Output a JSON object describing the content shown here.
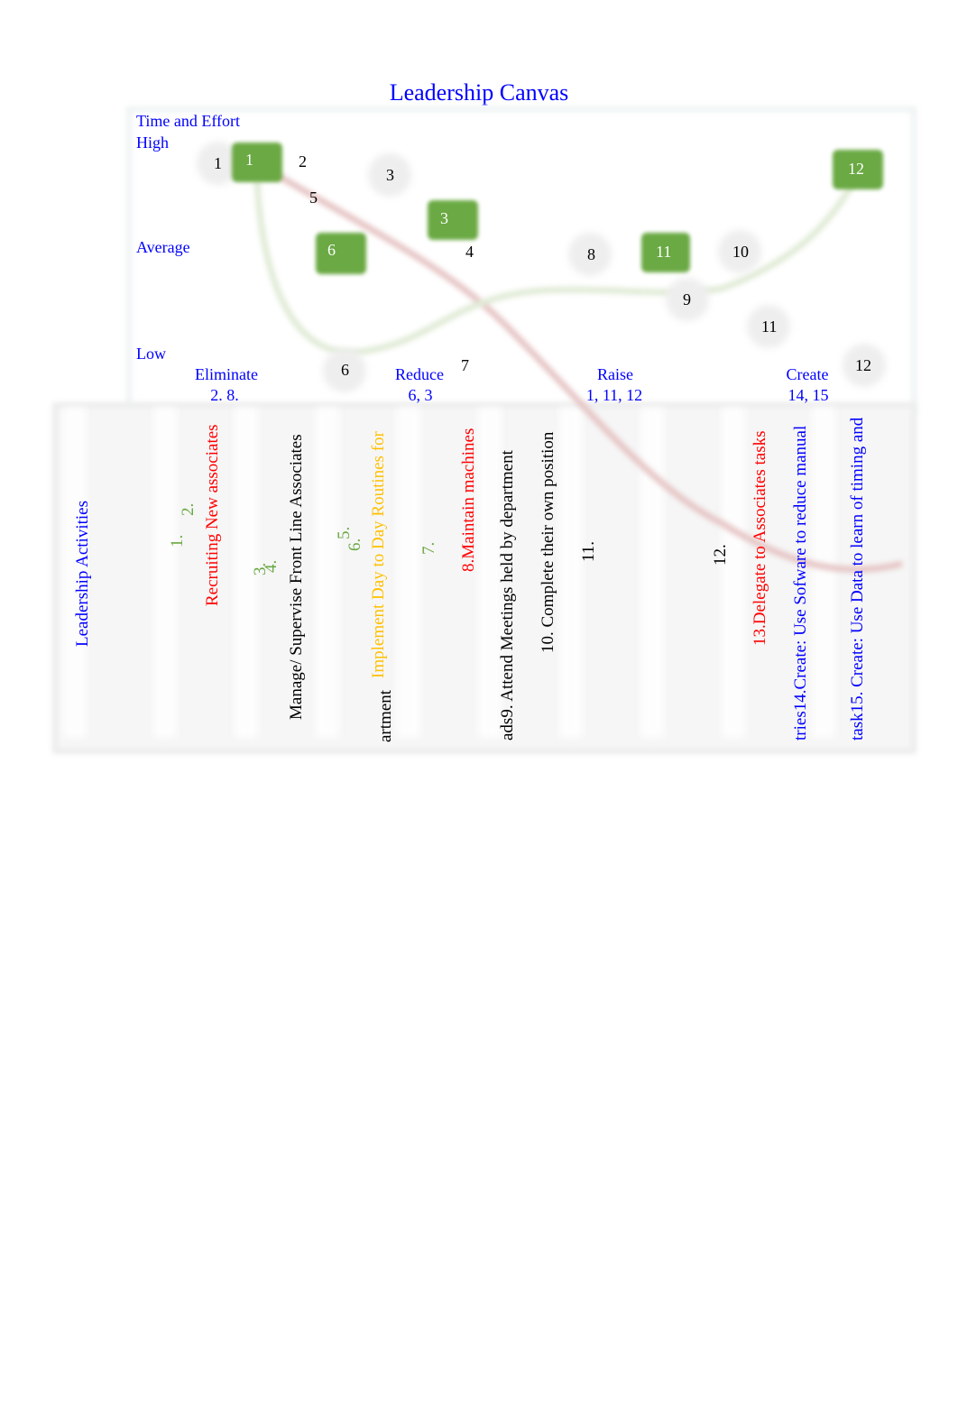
{
  "title": "Leadership Canvas",
  "axis": {
    "y_title": "Time and Effort",
    "high": "High",
    "average": "Average",
    "low": "Low"
  },
  "categories": [
    {
      "label": "Eliminate",
      "items": "2. 8."
    },
    {
      "label": "Reduce",
      "items": "6, 3"
    },
    {
      "label": "Raise",
      "items": "1, 11, 12"
    },
    {
      "label": "Create",
      "items": "14, 15"
    }
  ],
  "highlighted_points": [
    "1",
    "3",
    "6",
    "11",
    "12"
  ],
  "plain_points": [
    "1",
    "2",
    "3",
    "5",
    "4",
    "8",
    "10",
    "9",
    "11",
    "6",
    "7",
    "12"
  ],
  "colors": {
    "label": "#0000ff",
    "highlight": "#6aa943",
    "eliminate": "#ff0000",
    "reduce": "#ffc000",
    "red_curve": "#e8c8c8",
    "green_curve": "#e2ecd9"
  },
  "activities": {
    "header": "Leadership Activities",
    "n1": "1.",
    "n2": "2.",
    "a1": "Recruiting New associates",
    "n3": "3.",
    "n4": "4.",
    "a2": "Manage/ Supervise Front Line Associates",
    "n5": "5.",
    "n6": "6.",
    "a3": "Implement Day to Day Routines for",
    "a3b": "artment",
    "n7": "7.",
    "a4": "8.Maintain machines",
    "a5": "ads9. Attend Meetings held by department",
    "a6": "10. Complete their own position",
    "n11": "11.",
    "n12": "12.",
    "a7": "13.Delegate to Associates tasks",
    "a8": "tries14.Create: Use Sofware to reduce manual",
    "a9": "task15. Create: Use Data to learn of timing and"
  }
}
